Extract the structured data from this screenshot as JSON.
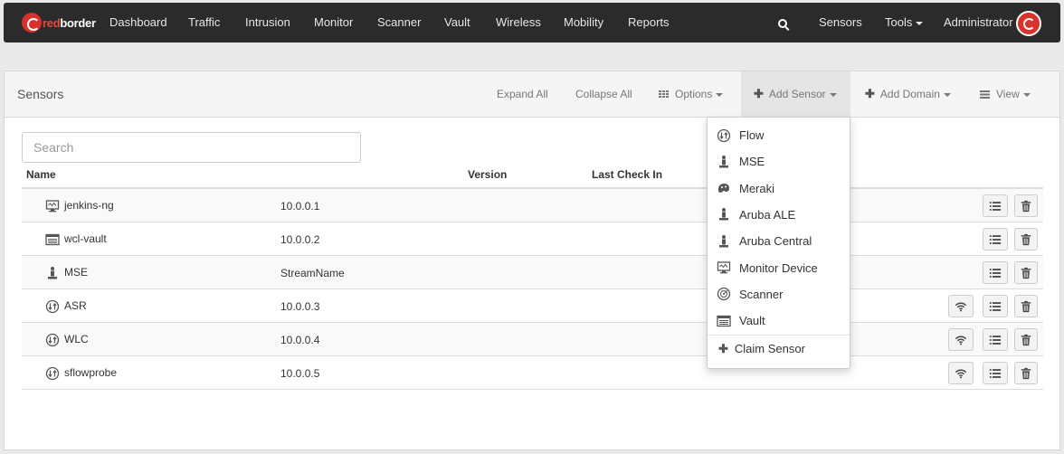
{
  "navbar": {
    "logo_text_red": "red",
    "logo_text_white": "border",
    "items": [
      "Dashboard",
      "Traffic",
      "Intrusion",
      "Monitor",
      "Scanner",
      "Vault",
      "Wireless",
      "Mobility",
      "Reports"
    ],
    "sensors": "Sensors",
    "tools": "Tools",
    "user": "Administrator"
  },
  "panel": {
    "title": "Sensors",
    "expand_all": "Expand All",
    "collapse_all": "Collapse All",
    "options": "Options",
    "add_sensor": "Add Sensor",
    "add_domain": "Add Domain",
    "view": "View"
  },
  "search": {
    "placeholder": "Search"
  },
  "table": {
    "headers": {
      "name": "Name",
      "version": "Version",
      "last_check_in": "Last Check In"
    },
    "rows": [
      {
        "name": "jenkins-ng",
        "ip": "10.0.0.1",
        "icon": "monitor-device-icon",
        "wireless": false
      },
      {
        "name": "wcl-vault",
        "ip": "10.0.0.2",
        "icon": "vault-icon",
        "wireless": false
      },
      {
        "name": "MSE",
        "ip": "StreamName",
        "icon": "mse-icon",
        "wireless": false
      },
      {
        "name": "ASR",
        "ip": "10.0.0.3",
        "icon": "flow-icon",
        "wireless": true
      },
      {
        "name": "WLC",
        "ip": "10.0.0.4",
        "icon": "flow-icon",
        "wireless": true
      },
      {
        "name": "sflowprobe",
        "ip": "10.0.0.5",
        "icon": "flow-icon",
        "wireless": true
      }
    ]
  },
  "add_sensor_menu": {
    "items": [
      {
        "label": "Flow",
        "icon": "flow-icon"
      },
      {
        "label": "MSE",
        "icon": "mse-icon"
      },
      {
        "label": "Meraki",
        "icon": "meraki-icon"
      },
      {
        "label": "Aruba ALE",
        "icon": "aruba-ale-icon"
      },
      {
        "label": "Aruba Central",
        "icon": "aruba-central-icon"
      },
      {
        "label": "Monitor Device",
        "icon": "monitor-device-icon"
      },
      {
        "label": "Scanner",
        "icon": "scanner-icon"
      },
      {
        "label": "Vault",
        "icon": "vault-icon"
      }
    ],
    "claim": "Claim Sensor"
  }
}
